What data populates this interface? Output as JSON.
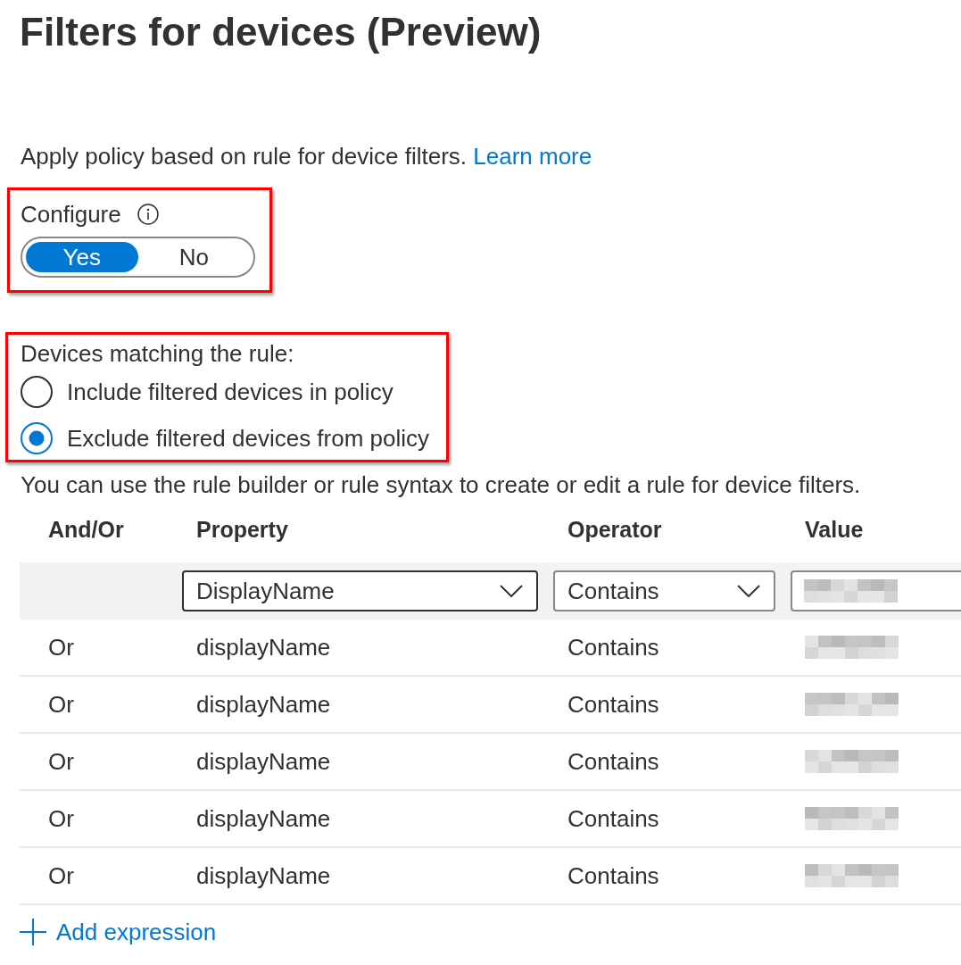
{
  "page": {
    "title": "Filters for devices (Preview)"
  },
  "description": {
    "text": "Apply policy based on rule for device filters.",
    "link": "Learn more"
  },
  "configure": {
    "label": "Configure",
    "highlighted": true,
    "options": [
      {
        "label": "Yes",
        "selected": true
      },
      {
        "label": "No",
        "selected": false
      }
    ]
  },
  "matching": {
    "label": "Devices matching the rule:",
    "highlighted": true,
    "options": [
      {
        "label": "Include filtered devices in policy",
        "selected": false
      },
      {
        "label": "Exclude filtered devices from policy",
        "selected": true
      }
    ]
  },
  "rule_hint": "You can use the rule builder or rule syntax to create or edit a rule for device filters.",
  "table": {
    "columns": [
      "And/Or",
      "Property",
      "Operator",
      "Value"
    ],
    "edit_row": {
      "property": "DisplayName",
      "operator": "Contains",
      "value_redacted": true
    },
    "rows": [
      {
        "and_or": "Or",
        "property": "displayName",
        "operator": "Contains",
        "value_redacted": true
      },
      {
        "and_or": "Or",
        "property": "displayName",
        "operator": "Contains",
        "value_redacted": true
      },
      {
        "and_or": "Or",
        "property": "displayName",
        "operator": "Contains",
        "value_redacted": true
      },
      {
        "and_or": "Or",
        "property": "displayName",
        "operator": "Contains",
        "value_redacted": true
      },
      {
        "and_or": "Or",
        "property": "displayName",
        "operator": "Contains",
        "value_redacted": true
      }
    ]
  },
  "add_expression": {
    "label": "Add expression"
  }
}
